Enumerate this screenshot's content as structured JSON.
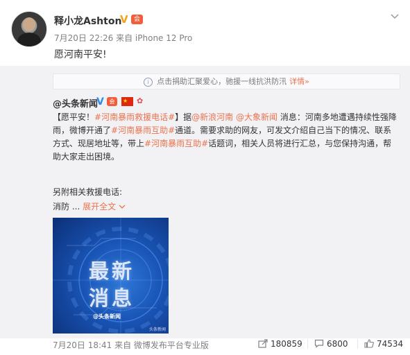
{
  "post": {
    "username": "释小龙Ashton",
    "meta": "7月20日 22:26 来自 iPhone 12 Pro",
    "content": "愿河南平安!"
  },
  "notice": {
    "text": "点击捐助汇聚爱心，驰援一线抗洪防汛",
    "link": "详情",
    "link_arrow": "»"
  },
  "repost": {
    "author": "@头条新闻",
    "badges": {
      "v": "V",
      "member": "会",
      "flag": "★"
    },
    "text_parts": [
      "【愿平安！",
      "#河南暴雨救援电话#",
      "】据",
      "@新浪河南",
      " ",
      "@大象新闻",
      " 消息：河南多地遭遇持续性强降雨，微博开通了",
      "#河南暴雨互助#",
      "通道。需要求助的网友，可发文介绍自己当下的情况、联系方式、现居地址等，带上",
      "#河南暴雨互助#",
      "话题词，相关人员将进行汇总，与您保持沟通，帮助大家走出困境。"
    ],
    "extra_line": "另附相关救援电话:",
    "truncated": "消防 ...",
    "expand_label": "展开全文",
    "image": {
      "line1": "最新",
      "line2": "消息",
      "logo": "@头条新闻",
      "watermark": "头条新闻"
    },
    "footer": {
      "time": "7月20日 18:41 来自 微博发布平台专业版",
      "repost_count": "180859",
      "comment_count": "6800",
      "like_count": "74534"
    }
  },
  "colors": {
    "accent": "#eb7350",
    "muted": "#808080",
    "repost_bg": "#f2f2f5"
  },
  "icons": [
    "chevron-down-icon",
    "info-icon",
    "repost-icon",
    "comment-icon",
    "like-icon"
  ]
}
